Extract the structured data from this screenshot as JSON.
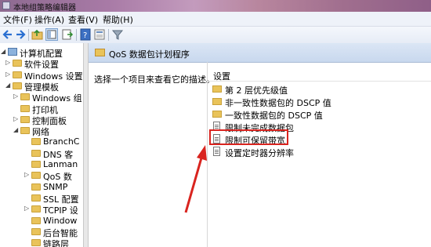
{
  "window": {
    "title": "本地组策略编辑器"
  },
  "menu": [
    "文件(F)",
    "操作(A)",
    "查看(V)",
    "帮助(H)"
  ],
  "toolbar": {
    "buttons": [
      "back-icon",
      "forward-icon",
      "up-folder-icon",
      "show-hide-tree-icon",
      "export-list-icon",
      "help-icon",
      "properties-icon",
      "filter-icon"
    ]
  },
  "tree": {
    "items": [
      {
        "label": "计算机配置",
        "kind": "computer",
        "arrow": "◢"
      },
      {
        "label": "软件设置",
        "kind": "folder",
        "arrow": "▷"
      },
      {
        "label": "Windows 设置",
        "kind": "folder",
        "arrow": "▷"
      },
      {
        "label": "管理模板",
        "kind": "folder",
        "arrow": "◢"
      },
      {
        "label": "Windows 组",
        "kind": "folder",
        "arrow": "▷"
      },
      {
        "label": "打印机",
        "kind": "folder",
        "arrow": ""
      },
      {
        "label": "控制面板",
        "kind": "folder",
        "arrow": "▷"
      },
      {
        "label": "网络",
        "kind": "folder",
        "arrow": "◢"
      },
      {
        "label": "BranchC",
        "kind": "folder",
        "arrow": ""
      },
      {
        "label": "DNS 客",
        "kind": "folder",
        "arrow": ""
      },
      {
        "label": "Lanman",
        "kind": "folder",
        "arrow": ""
      },
      {
        "label": "QoS 数",
        "kind": "folder",
        "arrow": "▷"
      },
      {
        "label": "SNMP",
        "kind": "folder",
        "arrow": ""
      },
      {
        "label": "SSL 配置",
        "kind": "folder",
        "arrow": ""
      },
      {
        "label": "TCPIP 设",
        "kind": "folder",
        "arrow": "▷"
      },
      {
        "label": "Window",
        "kind": "folder",
        "arrow": ""
      },
      {
        "label": "后台智能",
        "kind": "folder",
        "arrow": ""
      },
      {
        "label": "链路层",
        "kind": "folder",
        "arrow": ""
      }
    ]
  },
  "right": {
    "header": "QoS 数据包计划程序",
    "description": "选择一个项目来查看它的描述。",
    "column_header": "设置",
    "items": [
      {
        "label": "第 2 层优先级值",
        "kind": "folder"
      },
      {
        "label": "非一致性数据包的 DSCP 值",
        "kind": "folder"
      },
      {
        "label": "一致性数据包的 DSCP 值",
        "kind": "folder"
      },
      {
        "label": "限制未完成数据包",
        "kind": "setting"
      },
      {
        "label": "限制可保留带宽",
        "kind": "setting"
      },
      {
        "label": "设置定时器分辨率",
        "kind": "setting"
      }
    ]
  },
  "annotation": {
    "color": "#d9241f"
  }
}
